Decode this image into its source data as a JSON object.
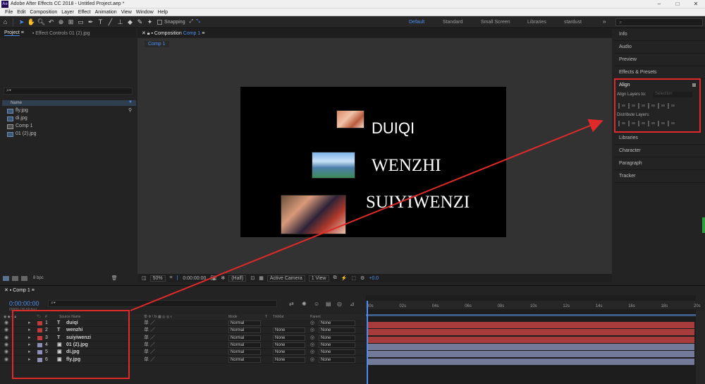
{
  "window": {
    "app_icon": "Ae",
    "title": "Adobe After Effects CC 2018 - Untitled Project.aep *",
    "controls": [
      "–",
      "□",
      "✕"
    ]
  },
  "menu": [
    "File",
    "Edit",
    "Composition",
    "Layer",
    "Effect",
    "Animation",
    "View",
    "Window",
    "Help"
  ],
  "toolbar": {
    "tools": [
      "selection-tool",
      "hand-tool",
      "zoom-tool",
      "rotate-tool",
      "camera-tool",
      "pan-behind-tool",
      "rectangle-tool",
      "pen-tool",
      "type-tool",
      "brush-tool",
      "clone-stamp-tool",
      "eraser-tool",
      "roto-brush-tool",
      "puppet-pin-tool"
    ],
    "snapping_label": "Snapping",
    "workspaces": [
      "Default",
      "Standard",
      "Small Screen",
      "Libraries",
      "stardust"
    ],
    "active_workspace": "Default",
    "search_placeholder": "⌕"
  },
  "project_panel": {
    "tabs": [
      "Project",
      "Effect Controls 01 (2).jpg"
    ],
    "search_placeholder": "⌕▾",
    "column_name": "Name",
    "items": [
      {
        "name": "fly.jpg",
        "kind": "image"
      },
      {
        "name": "di.jpg",
        "kind": "image"
      },
      {
        "name": "Comp 1",
        "kind": "comp"
      },
      {
        "name": "01 (2).jpg",
        "kind": "image"
      }
    ],
    "bpc": "8 bpc"
  },
  "composition": {
    "tab_label": "Composition",
    "tab_name": "Comp 1",
    "breadcrumb": "Comp 1",
    "canvas_texts": [
      "DUIQI",
      "WENZHI",
      "SUIYIWENZI"
    ],
    "viewer_bar": {
      "zoom": "50%",
      "timecode": "0:00:00:00",
      "resolution": "(Half)",
      "camera": "Active Camera",
      "views": "1 View",
      "exposure": "+0.0"
    }
  },
  "right_panels": {
    "items": [
      "Info",
      "Audio",
      "Preview",
      "Effects & Presets",
      "Align",
      "Libraries",
      "Character",
      "Paragraph",
      "Tracker"
    ],
    "align": {
      "title": "Align",
      "align_layers_to": "Align Layers to:",
      "align_target": "Selection",
      "distribute_layers": "Distribute Layers:"
    }
  },
  "timeline": {
    "tab": "Comp 1",
    "current_time": "0:00:00:00",
    "fps_info": "00000 (30.00 fps)",
    "search_placeholder": "⌕▾",
    "headers": {
      "label": "#",
      "source": "Source Name",
      "switches": "单 ✲ \\ fx ▦ ◎ ◎ ◐",
      "mode": "Mode",
      "t": "T",
      "trkmat": "TrkMat",
      "parent": "Parent"
    },
    "layers": [
      {
        "num": "1",
        "type": "T",
        "name": "duiqi",
        "mode": "Normal",
        "trkmat": "",
        "parent": "None",
        "label_color": "#c23b3b"
      },
      {
        "num": "2",
        "type": "T",
        "name": "wenzhi",
        "mode": "Normal",
        "trkmat": "None",
        "parent": "None",
        "label_color": "#c23b3b"
      },
      {
        "num": "3",
        "type": "T",
        "name": "suiyiwenzi",
        "mode": "Normal",
        "trkmat": "None",
        "parent": "None",
        "label_color": "#c23b3b"
      },
      {
        "num": "4",
        "type": "▣",
        "name": "01 (2).jpg",
        "mode": "Normal",
        "trkmat": "None",
        "parent": "None",
        "label_color": "#8f8fb8"
      },
      {
        "num": "5",
        "type": "▣",
        "name": "di.jpg",
        "mode": "Normal",
        "trkmat": "None",
        "parent": "None",
        "label_color": "#8f8fb8"
      },
      {
        "num": "6",
        "type": "▣",
        "name": "fly.jpg",
        "mode": "Normal",
        "trkmat": "None",
        "parent": "None",
        "label_color": "#8f8fb8"
      }
    ],
    "ruler": [
      "00s",
      "02s",
      "04s",
      "06s",
      "08s",
      "10s",
      "12s",
      "14s",
      "16s",
      "18s",
      "20s"
    ]
  },
  "colors": {
    "accent": "#4d8ff0",
    "annotation": "#e02a2a",
    "text_bar": "#a83b3b",
    "image_bar": "#737999"
  }
}
